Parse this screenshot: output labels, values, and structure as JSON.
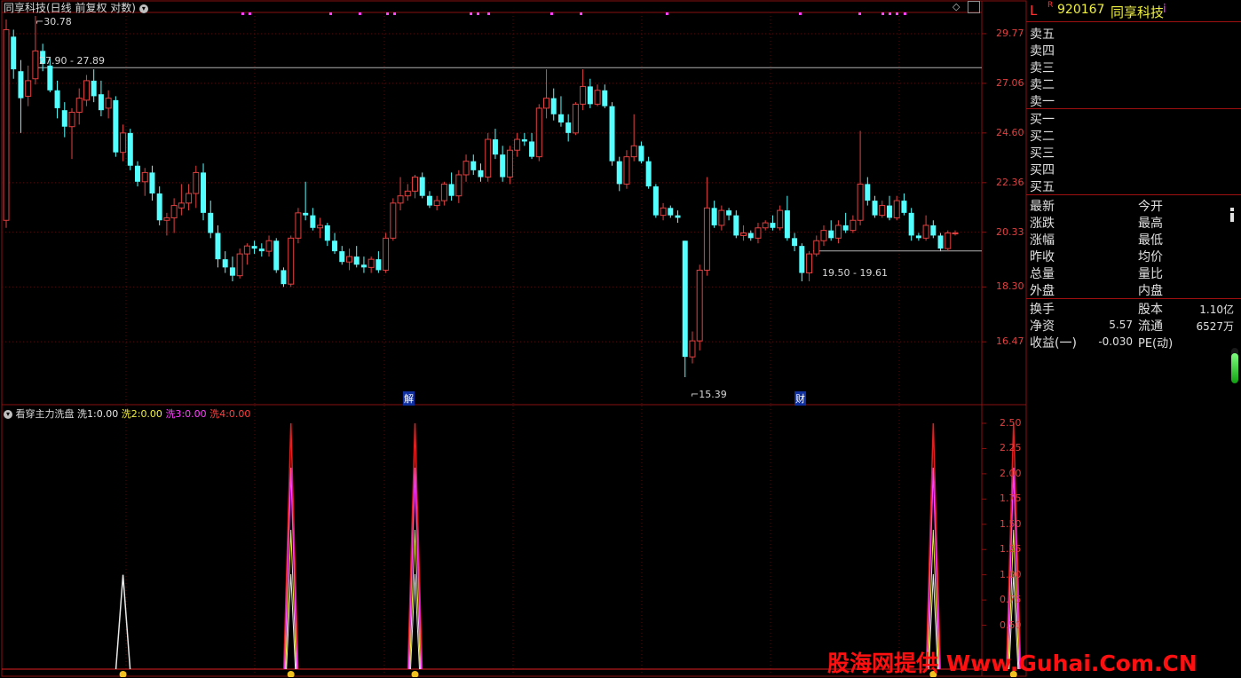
{
  "header": {
    "title": "同享科技(日线 前复权 对数)",
    "code": "920167",
    "name": "同享科技",
    "l_label": "L",
    "r_label": "R",
    "info_label": "i"
  },
  "colors": {
    "up": "#e04040",
    "down": "#54ffff",
    "grid": "#8a1010",
    "bg": "#000000"
  },
  "price_labels": {
    "max": "30.78",
    "min": "15.39",
    "line1": "27.90 - 27.89",
    "line2": "19.50 - 19.61",
    "event1": "解",
    "event2": "财"
  },
  "indicator": {
    "name": "看穿主力洗盘",
    "items": [
      {
        "label": "洗1:",
        "value": "0.00",
        "color": "#e8e8e8"
      },
      {
        "label": "洗2:",
        "value": "0.00",
        "color": "#f0f040"
      },
      {
        "label": "洗3:",
        "value": "0.00",
        "color": "#ff40ff"
      },
      {
        "label": "洗4:",
        "value": "0.00",
        "color": "#ff4040"
      }
    ]
  },
  "chart_data": [
    {
      "type": "candlestick",
      "title": "同享科技(日线 前复权 对数)",
      "y_ticks": [
        "29.77",
        "27.06",
        "24.60",
        "22.36",
        "20.33",
        "18.30",
        "16.47"
      ],
      "y_scale": "log",
      "ylim": [
        15.0,
        32.0
      ],
      "hlines": [
        27.89,
        19.61
      ],
      "annotations": [
        "30.78",
        "15.39",
        "27.90 - 27.89",
        "19.50 - 19.61",
        "解",
        "财"
      ],
      "candles": [
        {
          "o": 20.8,
          "h": 30.6,
          "l": 20.5,
          "c": 30.0
        },
        {
          "o": 29.6,
          "h": 30.0,
          "l": 27.3,
          "c": 27.8
        },
        {
          "o": 27.7,
          "h": 28.3,
          "l": 24.6,
          "c": 26.3
        },
        {
          "o": 26.4,
          "h": 28.0,
          "l": 25.9,
          "c": 27.2
        },
        {
          "o": 27.3,
          "h": 30.8,
          "l": 27.0,
          "c": 28.8
        },
        {
          "o": 28.8,
          "h": 29.2,
          "l": 27.7,
          "c": 28.1
        },
        {
          "o": 28.0,
          "h": 28.4,
          "l": 26.6,
          "c": 26.7
        },
        {
          "o": 26.7,
          "h": 27.2,
          "l": 25.3,
          "c": 25.8
        },
        {
          "o": 25.7,
          "h": 26.1,
          "l": 24.4,
          "c": 24.9
        },
        {
          "o": 24.9,
          "h": 25.8,
          "l": 23.4,
          "c": 25.6
        },
        {
          "o": 25.6,
          "h": 26.8,
          "l": 25.0,
          "c": 26.3
        },
        {
          "o": 26.2,
          "h": 27.5,
          "l": 25.9,
          "c": 27.2
        },
        {
          "o": 27.2,
          "h": 27.8,
          "l": 26.1,
          "c": 26.4
        },
        {
          "o": 26.5,
          "h": 27.2,
          "l": 25.4,
          "c": 25.7
        },
        {
          "o": 25.8,
          "h": 26.7,
          "l": 25.3,
          "c": 26.3
        },
        {
          "o": 26.2,
          "h": 26.4,
          "l": 23.5,
          "c": 23.7
        },
        {
          "o": 23.7,
          "h": 25.0,
          "l": 23.3,
          "c": 24.6
        },
        {
          "o": 24.6,
          "h": 24.8,
          "l": 22.9,
          "c": 23.1
        },
        {
          "o": 23.1,
          "h": 23.3,
          "l": 22.2,
          "c": 22.4
        },
        {
          "o": 22.4,
          "h": 23.0,
          "l": 21.8,
          "c": 22.8
        },
        {
          "o": 22.8,
          "h": 23.1,
          "l": 21.6,
          "c": 21.9
        },
        {
          "o": 21.9,
          "h": 22.2,
          "l": 20.6,
          "c": 20.8
        },
        {
          "o": 20.8,
          "h": 21.1,
          "l": 20.2,
          "c": 20.9
        },
        {
          "o": 20.9,
          "h": 21.7,
          "l": 20.3,
          "c": 21.4
        },
        {
          "o": 21.3,
          "h": 22.3,
          "l": 21.0,
          "c": 21.5
        },
        {
          "o": 21.5,
          "h": 22.3,
          "l": 21.2,
          "c": 21.9
        },
        {
          "o": 21.9,
          "h": 23.1,
          "l": 21.3,
          "c": 22.8
        },
        {
          "o": 22.8,
          "h": 23.2,
          "l": 20.8,
          "c": 21.1
        },
        {
          "o": 21.1,
          "h": 21.6,
          "l": 20.1,
          "c": 20.3
        },
        {
          "o": 20.3,
          "h": 20.6,
          "l": 19.0,
          "c": 19.3
        },
        {
          "o": 19.3,
          "h": 19.6,
          "l": 18.8,
          "c": 19.0
        },
        {
          "o": 19.0,
          "h": 19.4,
          "l": 18.5,
          "c": 18.7
        },
        {
          "o": 18.7,
          "h": 19.7,
          "l": 18.6,
          "c": 19.5
        },
        {
          "o": 19.5,
          "h": 19.9,
          "l": 19.1,
          "c": 19.8
        },
        {
          "o": 19.8,
          "h": 20.0,
          "l": 19.5,
          "c": 19.7
        },
        {
          "o": 19.7,
          "h": 19.9,
          "l": 19.4,
          "c": 19.6
        },
        {
          "o": 19.6,
          "h": 20.2,
          "l": 19.4,
          "c": 20.0
        },
        {
          "o": 20.0,
          "h": 20.1,
          "l": 18.8,
          "c": 18.9
        },
        {
          "o": 18.9,
          "h": 19.0,
          "l": 18.3,
          "c": 18.4
        },
        {
          "o": 18.4,
          "h": 20.2,
          "l": 18.3,
          "c": 20.1
        },
        {
          "o": 20.1,
          "h": 21.3,
          "l": 19.9,
          "c": 21.1
        },
        {
          "o": 21.1,
          "h": 22.4,
          "l": 20.8,
          "c": 21.0
        },
        {
          "o": 21.0,
          "h": 21.3,
          "l": 20.4,
          "c": 20.5
        },
        {
          "o": 20.5,
          "h": 20.9,
          "l": 20.1,
          "c": 20.6
        },
        {
          "o": 20.6,
          "h": 20.7,
          "l": 19.8,
          "c": 20.0
        },
        {
          "o": 20.0,
          "h": 20.3,
          "l": 19.5,
          "c": 19.6
        },
        {
          "o": 19.6,
          "h": 19.8,
          "l": 19.1,
          "c": 19.2
        },
        {
          "o": 19.2,
          "h": 19.7,
          "l": 18.9,
          "c": 19.4
        },
        {
          "o": 19.4,
          "h": 19.8,
          "l": 19.0,
          "c": 19.1
        },
        {
          "o": 19.1,
          "h": 19.4,
          "l": 18.8,
          "c": 19.0
        },
        {
          "o": 19.0,
          "h": 19.4,
          "l": 18.8,
          "c": 19.3
        },
        {
          "o": 19.3,
          "h": 19.6,
          "l": 18.8,
          "c": 18.9
        },
        {
          "o": 18.9,
          "h": 20.3,
          "l": 18.8,
          "c": 20.1
        },
        {
          "o": 20.1,
          "h": 21.7,
          "l": 20.0,
          "c": 21.5
        },
        {
          "o": 21.5,
          "h": 22.6,
          "l": 21.2,
          "c": 21.8
        },
        {
          "o": 21.8,
          "h": 22.3,
          "l": 21.6,
          "c": 22.0
        },
        {
          "o": 22.0,
          "h": 22.7,
          "l": 21.7,
          "c": 22.6
        },
        {
          "o": 22.6,
          "h": 22.8,
          "l": 21.7,
          "c": 21.8
        },
        {
          "o": 21.8,
          "h": 22.0,
          "l": 21.3,
          "c": 21.4
        },
        {
          "o": 21.4,
          "h": 21.8,
          "l": 21.2,
          "c": 21.6
        },
        {
          "o": 21.6,
          "h": 22.4,
          "l": 21.4,
          "c": 22.3
        },
        {
          "o": 22.3,
          "h": 22.8,
          "l": 21.6,
          "c": 21.8
        },
        {
          "o": 21.8,
          "h": 22.9,
          "l": 21.5,
          "c": 22.7
        },
        {
          "o": 22.7,
          "h": 23.6,
          "l": 22.4,
          "c": 23.3
        },
        {
          "o": 23.3,
          "h": 23.6,
          "l": 22.7,
          "c": 22.9
        },
        {
          "o": 22.9,
          "h": 23.2,
          "l": 22.4,
          "c": 22.6
        },
        {
          "o": 22.6,
          "h": 24.6,
          "l": 22.4,
          "c": 24.3
        },
        {
          "o": 24.3,
          "h": 24.8,
          "l": 23.4,
          "c": 23.6
        },
        {
          "o": 23.6,
          "h": 24.0,
          "l": 22.4,
          "c": 22.6
        },
        {
          "o": 22.6,
          "h": 24.0,
          "l": 22.3,
          "c": 23.8
        },
        {
          "o": 23.8,
          "h": 24.6,
          "l": 23.5,
          "c": 24.3
        },
        {
          "o": 24.3,
          "h": 24.6,
          "l": 24.0,
          "c": 24.2
        },
        {
          "o": 24.2,
          "h": 24.6,
          "l": 23.4,
          "c": 23.5
        },
        {
          "o": 23.5,
          "h": 26.0,
          "l": 23.3,
          "c": 25.8
        },
        {
          "o": 25.8,
          "h": 27.8,
          "l": 25.3,
          "c": 26.3
        },
        {
          "o": 26.3,
          "h": 26.8,
          "l": 25.2,
          "c": 25.5
        },
        {
          "o": 25.5,
          "h": 26.4,
          "l": 24.9,
          "c": 25.1
        },
        {
          "o": 25.1,
          "h": 25.5,
          "l": 24.2,
          "c": 24.6
        },
        {
          "o": 24.6,
          "h": 26.1,
          "l": 24.5,
          "c": 26.0
        },
        {
          "o": 26.0,
          "h": 27.8,
          "l": 25.7,
          "c": 26.9
        },
        {
          "o": 26.9,
          "h": 27.3,
          "l": 25.8,
          "c": 26.0
        },
        {
          "o": 26.0,
          "h": 27.0,
          "l": 25.9,
          "c": 26.7
        },
        {
          "o": 26.7,
          "h": 27.0,
          "l": 25.8,
          "c": 25.9
        },
        {
          "o": 25.9,
          "h": 26.1,
          "l": 23.1,
          "c": 23.3
        },
        {
          "o": 23.3,
          "h": 23.5,
          "l": 22.0,
          "c": 22.3
        },
        {
          "o": 22.3,
          "h": 23.8,
          "l": 22.1,
          "c": 23.5
        },
        {
          "o": 23.5,
          "h": 25.5,
          "l": 23.3,
          "c": 24.0
        },
        {
          "o": 24.0,
          "h": 24.2,
          "l": 23.2,
          "c": 23.3
        },
        {
          "o": 23.3,
          "h": 23.5,
          "l": 22.1,
          "c": 22.2
        },
        {
          "o": 22.2,
          "h": 22.3,
          "l": 20.9,
          "c": 21.0
        },
        {
          "o": 21.0,
          "h": 21.5,
          "l": 20.8,
          "c": 21.3
        },
        {
          "o": 21.3,
          "h": 21.4,
          "l": 20.9,
          "c": 21.0
        },
        {
          "o": 21.0,
          "h": 21.2,
          "l": 20.7,
          "c": 20.9
        },
        {
          "o": 20.0,
          "h": 20.0,
          "l": 15.39,
          "c": 16.0
        },
        {
          "o": 16.0,
          "h": 16.8,
          "l": 15.8,
          "c": 16.5
        },
        {
          "o": 16.5,
          "h": 19.1,
          "l": 16.2,
          "c": 18.9
        },
        {
          "o": 18.9,
          "h": 22.6,
          "l": 18.7,
          "c": 21.3
        },
        {
          "o": 21.3,
          "h": 21.6,
          "l": 20.5,
          "c": 20.6
        },
        {
          "o": 20.6,
          "h": 21.4,
          "l": 20.4,
          "c": 21.2
        },
        {
          "o": 21.2,
          "h": 21.3,
          "l": 20.8,
          "c": 21.0
        },
        {
          "o": 21.0,
          "h": 21.2,
          "l": 20.1,
          "c": 20.2
        },
        {
          "o": 20.2,
          "h": 20.6,
          "l": 20.0,
          "c": 20.3
        },
        {
          "o": 20.3,
          "h": 20.4,
          "l": 20.0,
          "c": 20.1
        },
        {
          "o": 20.1,
          "h": 20.7,
          "l": 19.9,
          "c": 20.5
        },
        {
          "o": 20.5,
          "h": 20.8,
          "l": 20.4,
          "c": 20.7
        },
        {
          "o": 20.7,
          "h": 21.0,
          "l": 20.4,
          "c": 20.5
        },
        {
          "o": 20.5,
          "h": 21.4,
          "l": 20.4,
          "c": 21.2
        },
        {
          "o": 21.2,
          "h": 21.8,
          "l": 20.0,
          "c": 20.1
        },
        {
          "o": 20.1,
          "h": 20.3,
          "l": 19.6,
          "c": 19.8
        },
        {
          "o": 19.8,
          "h": 19.9,
          "l": 18.5,
          "c": 18.8
        },
        {
          "o": 18.8,
          "h": 19.6,
          "l": 18.5,
          "c": 19.5
        },
        {
          "o": 19.5,
          "h": 20.2,
          "l": 19.4,
          "c": 20.0
        },
        {
          "o": 20.0,
          "h": 20.6,
          "l": 19.8,
          "c": 20.4
        },
        {
          "o": 20.4,
          "h": 20.8,
          "l": 20.0,
          "c": 20.1
        },
        {
          "o": 20.1,
          "h": 20.8,
          "l": 19.9,
          "c": 20.6
        },
        {
          "o": 20.6,
          "h": 21.1,
          "l": 20.3,
          "c": 20.4
        },
        {
          "o": 20.4,
          "h": 21.0,
          "l": 20.3,
          "c": 20.8
        },
        {
          "o": 20.8,
          "h": 24.7,
          "l": 20.6,
          "c": 22.3
        },
        {
          "o": 22.3,
          "h": 22.6,
          "l": 21.4,
          "c": 21.6
        },
        {
          "o": 21.6,
          "h": 21.8,
          "l": 20.9,
          "c": 21.0
        },
        {
          "o": 21.0,
          "h": 21.6,
          "l": 20.9,
          "c": 21.4
        },
        {
          "o": 21.4,
          "h": 21.8,
          "l": 20.8,
          "c": 20.9
        },
        {
          "o": 20.9,
          "h": 21.8,
          "l": 20.8,
          "c": 21.6
        },
        {
          "o": 21.6,
          "h": 21.9,
          "l": 21.0,
          "c": 21.1
        },
        {
          "o": 21.1,
          "h": 21.3,
          "l": 20.0,
          "c": 20.2
        },
        {
          "o": 20.2,
          "h": 20.3,
          "l": 20.0,
          "c": 20.1
        },
        {
          "o": 20.1,
          "h": 21.0,
          "l": 20.0,
          "c": 20.6
        },
        {
          "o": 20.6,
          "h": 20.8,
          "l": 20.1,
          "c": 20.2
        },
        {
          "o": 20.2,
          "h": 20.3,
          "l": 19.6,
          "c": 19.7
        },
        {
          "o": 19.7,
          "h": 20.4,
          "l": 19.6,
          "c": 20.3
        },
        {
          "o": 20.3,
          "h": 20.4,
          "l": 20.2,
          "c": 20.3
        }
      ]
    },
    {
      "type": "line",
      "title": "看穿主力洗盘",
      "y_ticks": [
        "2.50",
        "2.25",
        "2.00",
        "1.75",
        "1.50",
        "1.25",
        "1.00",
        "0.75",
        "0.50"
      ],
      "ylim": [
        0,
        2.5
      ],
      "spikes": [
        {
          "index": 16,
          "value": 1.0
        },
        {
          "index": 39,
          "value": 2.5
        },
        {
          "index": 56,
          "value": 2.5
        },
        {
          "index": 127,
          "value": 2.5
        },
        {
          "index": 138,
          "value": 2.5
        }
      ],
      "series": [
        {
          "name": "洗1",
          "color": "#e8e8e8"
        },
        {
          "name": "洗2",
          "color": "#f0f040"
        },
        {
          "name": "洗3",
          "color": "#ff40ff"
        },
        {
          "name": "洗4",
          "color": "#ff4040"
        }
      ]
    }
  ],
  "order_book": {
    "sell": [
      "卖五",
      "卖四",
      "卖三",
      "卖二",
      "卖一"
    ],
    "buy": [
      "买一",
      "买二",
      "买三",
      "买四",
      "买五"
    ]
  },
  "quote": {
    "left": [
      "最新",
      "涨跌",
      "涨幅",
      "昨收",
      "总量",
      "外盘"
    ],
    "right": [
      "今开",
      "最高",
      "最低",
      "均价",
      "量比",
      "内盘"
    ]
  },
  "stats": [
    {
      "l1": "换手",
      "v1": "",
      "l2": "股本",
      "v2": "1.10亿"
    },
    {
      "l1": "净资",
      "v1": "5.57",
      "l2": "流通",
      "v2": "6527万"
    },
    {
      "l1": "收益(一)",
      "v1": "-0.030",
      "l2": "PE(动)",
      "v2": ""
    }
  ],
  "watermark": "股海网提供 Www.Guhai.Com.CN"
}
